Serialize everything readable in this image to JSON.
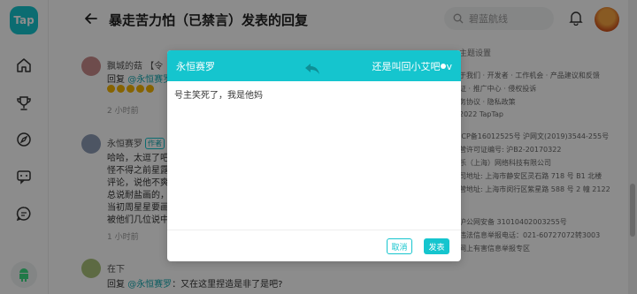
{
  "app": {
    "logo": "Tap"
  },
  "sidebar": {
    "items": [
      {
        "icon": "home-icon"
      },
      {
        "icon": "trophy-icon"
      },
      {
        "icon": "explore-icon"
      },
      {
        "icon": "chat-icon"
      },
      {
        "icon": "message-icon"
      }
    ],
    "android_icon": "android-icon"
  },
  "header": {
    "title": "暴走苦力怕（已禁言）发表的回复",
    "search_placeholder": "碧蓝航线"
  },
  "comments": [
    {
      "name": "飘城的菇",
      "name_suffix": "【令",
      "line1_prefix": "回复 ",
      "line1_mention": "@永恒赛罗",
      "time": "2 小时前"
    },
    {
      "name": "永恒赛罗",
      "tag": "作者",
      "lines": [
        "哈哈，太逗了吧",
        "怪不得之前星露",
        "评论，说他不爽",
        "总说耐盐画的，",
        "当初周星星要画",
        "被他们几位说中"
      ],
      "time": "1 小时前"
    },
    {
      "name": "在下",
      "line1_prefix": "回复 ",
      "line1_mention": "@永恒赛罗",
      "line1_suffix": "：又在这里捏造是非了是吧?"
    }
  ],
  "footer": {
    "title": "主题设置",
    "lines": [
      "于我们 · 开发者 · 工作机会 · 产品建议和反馈",
      "证 · 推广中心 · 侵权投诉",
      "务协议 · 隐私政策",
      "2022 TapTap",
      "ICP备16012525号  沪网文(2019)3544-255号",
      "营许可证编号: 沪B2-20170322",
      "乐（上海）网络科技有限公司",
      "司地址: 上海市静安区灵石路 718 号 B1 北楼",
      "营地址: 上海市闵行区紫星路 588 号 2 幢 2122",
      "沪公网安备 31010402003255号",
      "违法信息举报电话：021-60727072转3003",
      "网上有害信息举报专区"
    ]
  },
  "modal": {
    "from_user": "永恒赛罗",
    "to_user": "还是叫回小艾吧",
    "to_suffix": "v",
    "reply_text": "号主笑死了，我是他妈",
    "cancel_label": "取消",
    "send_label": "发表"
  },
  "colors": {
    "accent": "#15c5ce",
    "overlay": "rgba(0,0,0,0.45)"
  }
}
